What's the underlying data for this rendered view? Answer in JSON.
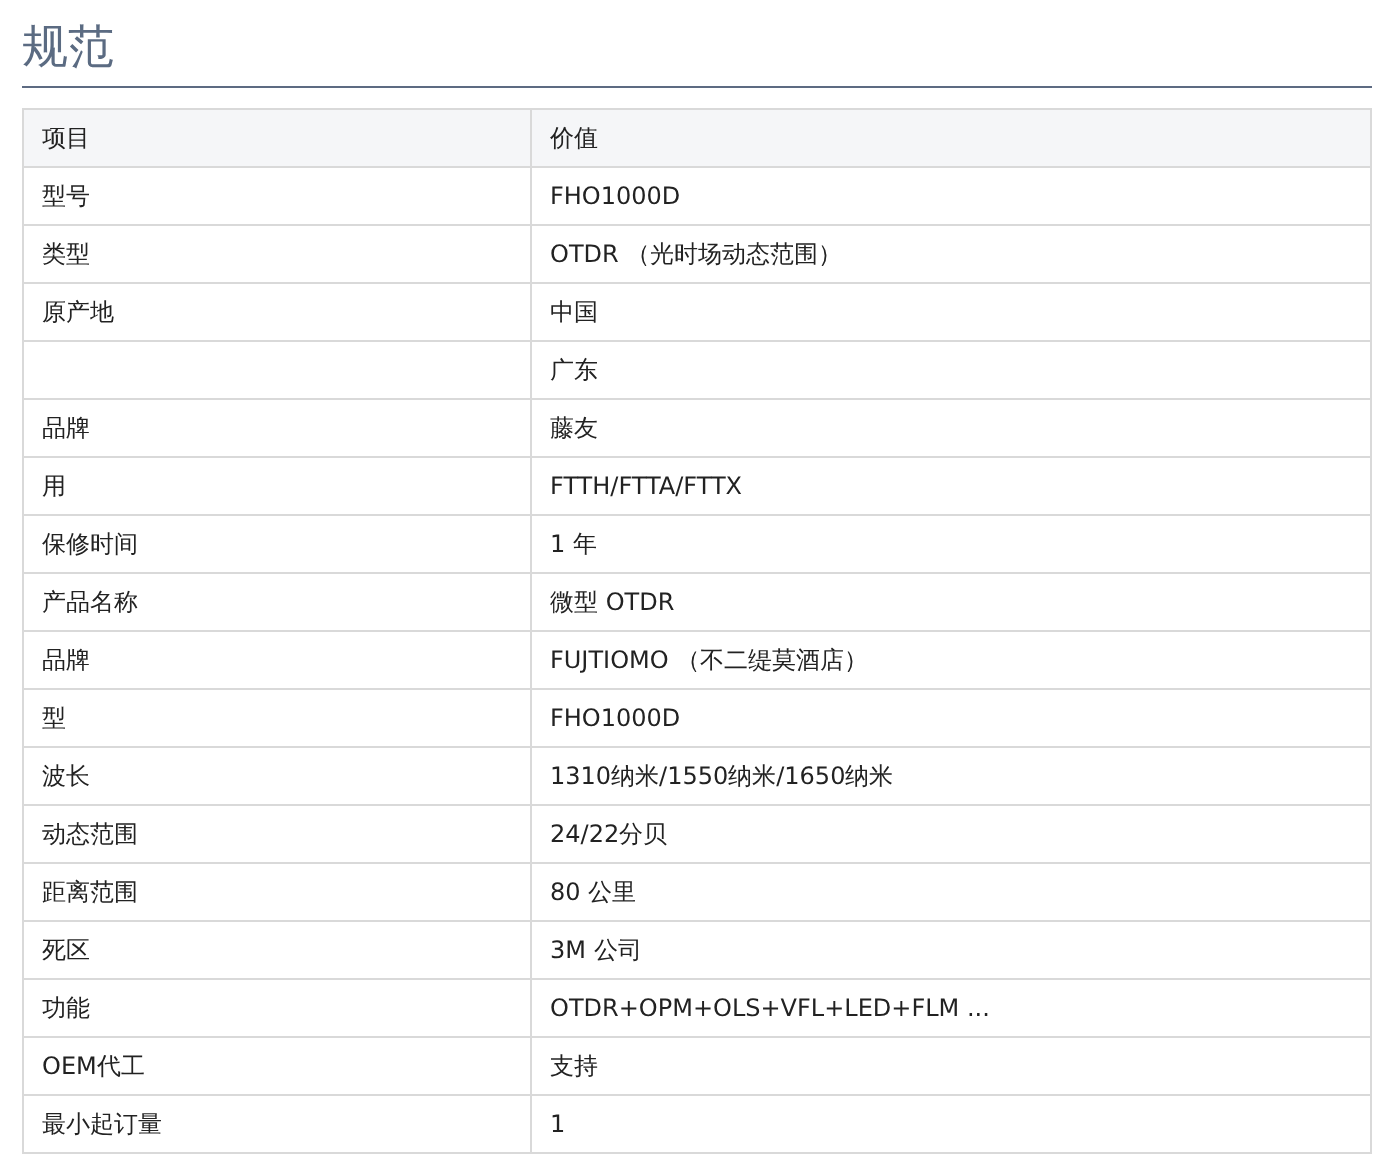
{
  "title": "规范",
  "table": {
    "columns": [
      "项目",
      "价值"
    ],
    "rows": [
      [
        "型号",
        "FHO1000D"
      ],
      [
        "类型",
        "OTDR （光时场动态范围）"
      ],
      [
        "原产地",
        "中国"
      ],
      [
        "",
        "广东"
      ],
      [
        "品牌",
        "藤友"
      ],
      [
        "用",
        "FTTH/FTTA/FTTX"
      ],
      [
        "保修时间",
        "1 年"
      ],
      [
        "产品名称",
        "微型 OTDR"
      ],
      [
        "品牌",
        "FUJTIOMO （不二缇莫酒店）"
      ],
      [
        "型",
        "FHO1000D"
      ],
      [
        "波长",
        "1310纳米/1550纳米/1650纳米"
      ],
      [
        "动态范围",
        "24/22分贝"
      ],
      [
        "距离范围",
        "80 公里"
      ],
      [
        "死区",
        "3M 公司"
      ],
      [
        "功能",
        "OTDR+OPM+OLS+VFL+LED+FLM ..."
      ],
      [
        "OEM代工",
        "支持"
      ],
      [
        "最小起订量",
        "1"
      ]
    ]
  }
}
